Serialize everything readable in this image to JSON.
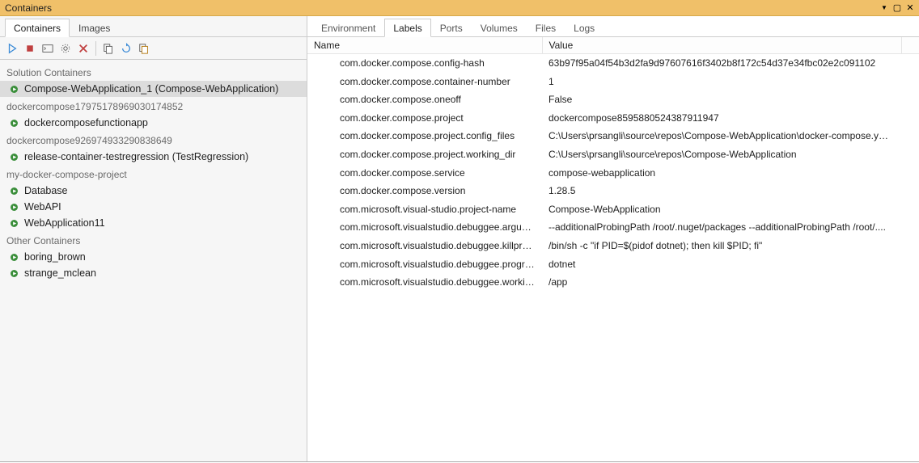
{
  "title": "Containers",
  "left_tabs": {
    "containers": "Containers",
    "images": "Images"
  },
  "toolbar": {
    "start": "start",
    "stop": "stop",
    "terminal": "terminal",
    "settings": "settings",
    "delete": "delete",
    "copy": "copy",
    "refresh": "refresh",
    "prune": "prune"
  },
  "groups": [
    {
      "label": "Solution Containers",
      "items": [
        {
          "label": "Compose-WebApplication_1 (Compose-WebApplication)",
          "selected": true
        }
      ]
    },
    {
      "label": "dockercompose17975178969030174852",
      "items": [
        {
          "label": "dockercomposefunctionapp"
        }
      ]
    },
    {
      "label": "dockercompose926974933290838649",
      "items": [
        {
          "label": "release-container-testregression (TestRegression)"
        }
      ]
    },
    {
      "label": "my-docker-compose-project",
      "items": [
        {
          "label": "Database"
        },
        {
          "label": "WebAPI"
        },
        {
          "label": "WebApplication11"
        }
      ]
    },
    {
      "label": "Other Containers",
      "items": [
        {
          "label": "boring_brown"
        },
        {
          "label": "strange_mclean"
        }
      ]
    }
  ],
  "right_tabs": {
    "environment": "Environment",
    "labels": "Labels",
    "ports": "Ports",
    "volumes": "Volumes",
    "files": "Files",
    "logs": "Logs"
  },
  "table_headers": {
    "name": "Name",
    "value": "Value"
  },
  "labels": [
    {
      "name": "com.docker.compose.config-hash",
      "value": "63b97f95a04f54b3d2fa9d97607616f3402b8f172c54d37e34fbc02e2c091102"
    },
    {
      "name": "com.docker.compose.container-number",
      "value": "1"
    },
    {
      "name": "com.docker.compose.oneoff",
      "value": "False"
    },
    {
      "name": "com.docker.compose.project",
      "value": "dockercompose8595880524387911947"
    },
    {
      "name": "com.docker.compose.project.config_files",
      "value": "C:\\Users\\prsangli\\source\\repos\\Compose-WebApplication\\docker-compose.yml..."
    },
    {
      "name": "com.docker.compose.project.working_dir",
      "value": "C:\\Users\\prsangli\\source\\repos\\Compose-WebApplication"
    },
    {
      "name": "com.docker.compose.service",
      "value": "compose-webapplication"
    },
    {
      "name": "com.docker.compose.version",
      "value": "1.28.5"
    },
    {
      "name": "com.microsoft.visual-studio.project-name",
      "value": "Compose-WebApplication"
    },
    {
      "name": "com.microsoft.visualstudio.debuggee.arguments",
      "value": " --additionalProbingPath /root/.nuget/packages --additionalProbingPath /root/...."
    },
    {
      "name": "com.microsoft.visualstudio.debuggee.killprogram",
      "value": "/bin/sh -c \"if PID=$(pidof dotnet); then kill $PID; fi\""
    },
    {
      "name": "com.microsoft.visualstudio.debuggee.program",
      "value": "dotnet"
    },
    {
      "name": "com.microsoft.visualstudio.debuggee.workingdire...",
      "value": "/app"
    }
  ]
}
